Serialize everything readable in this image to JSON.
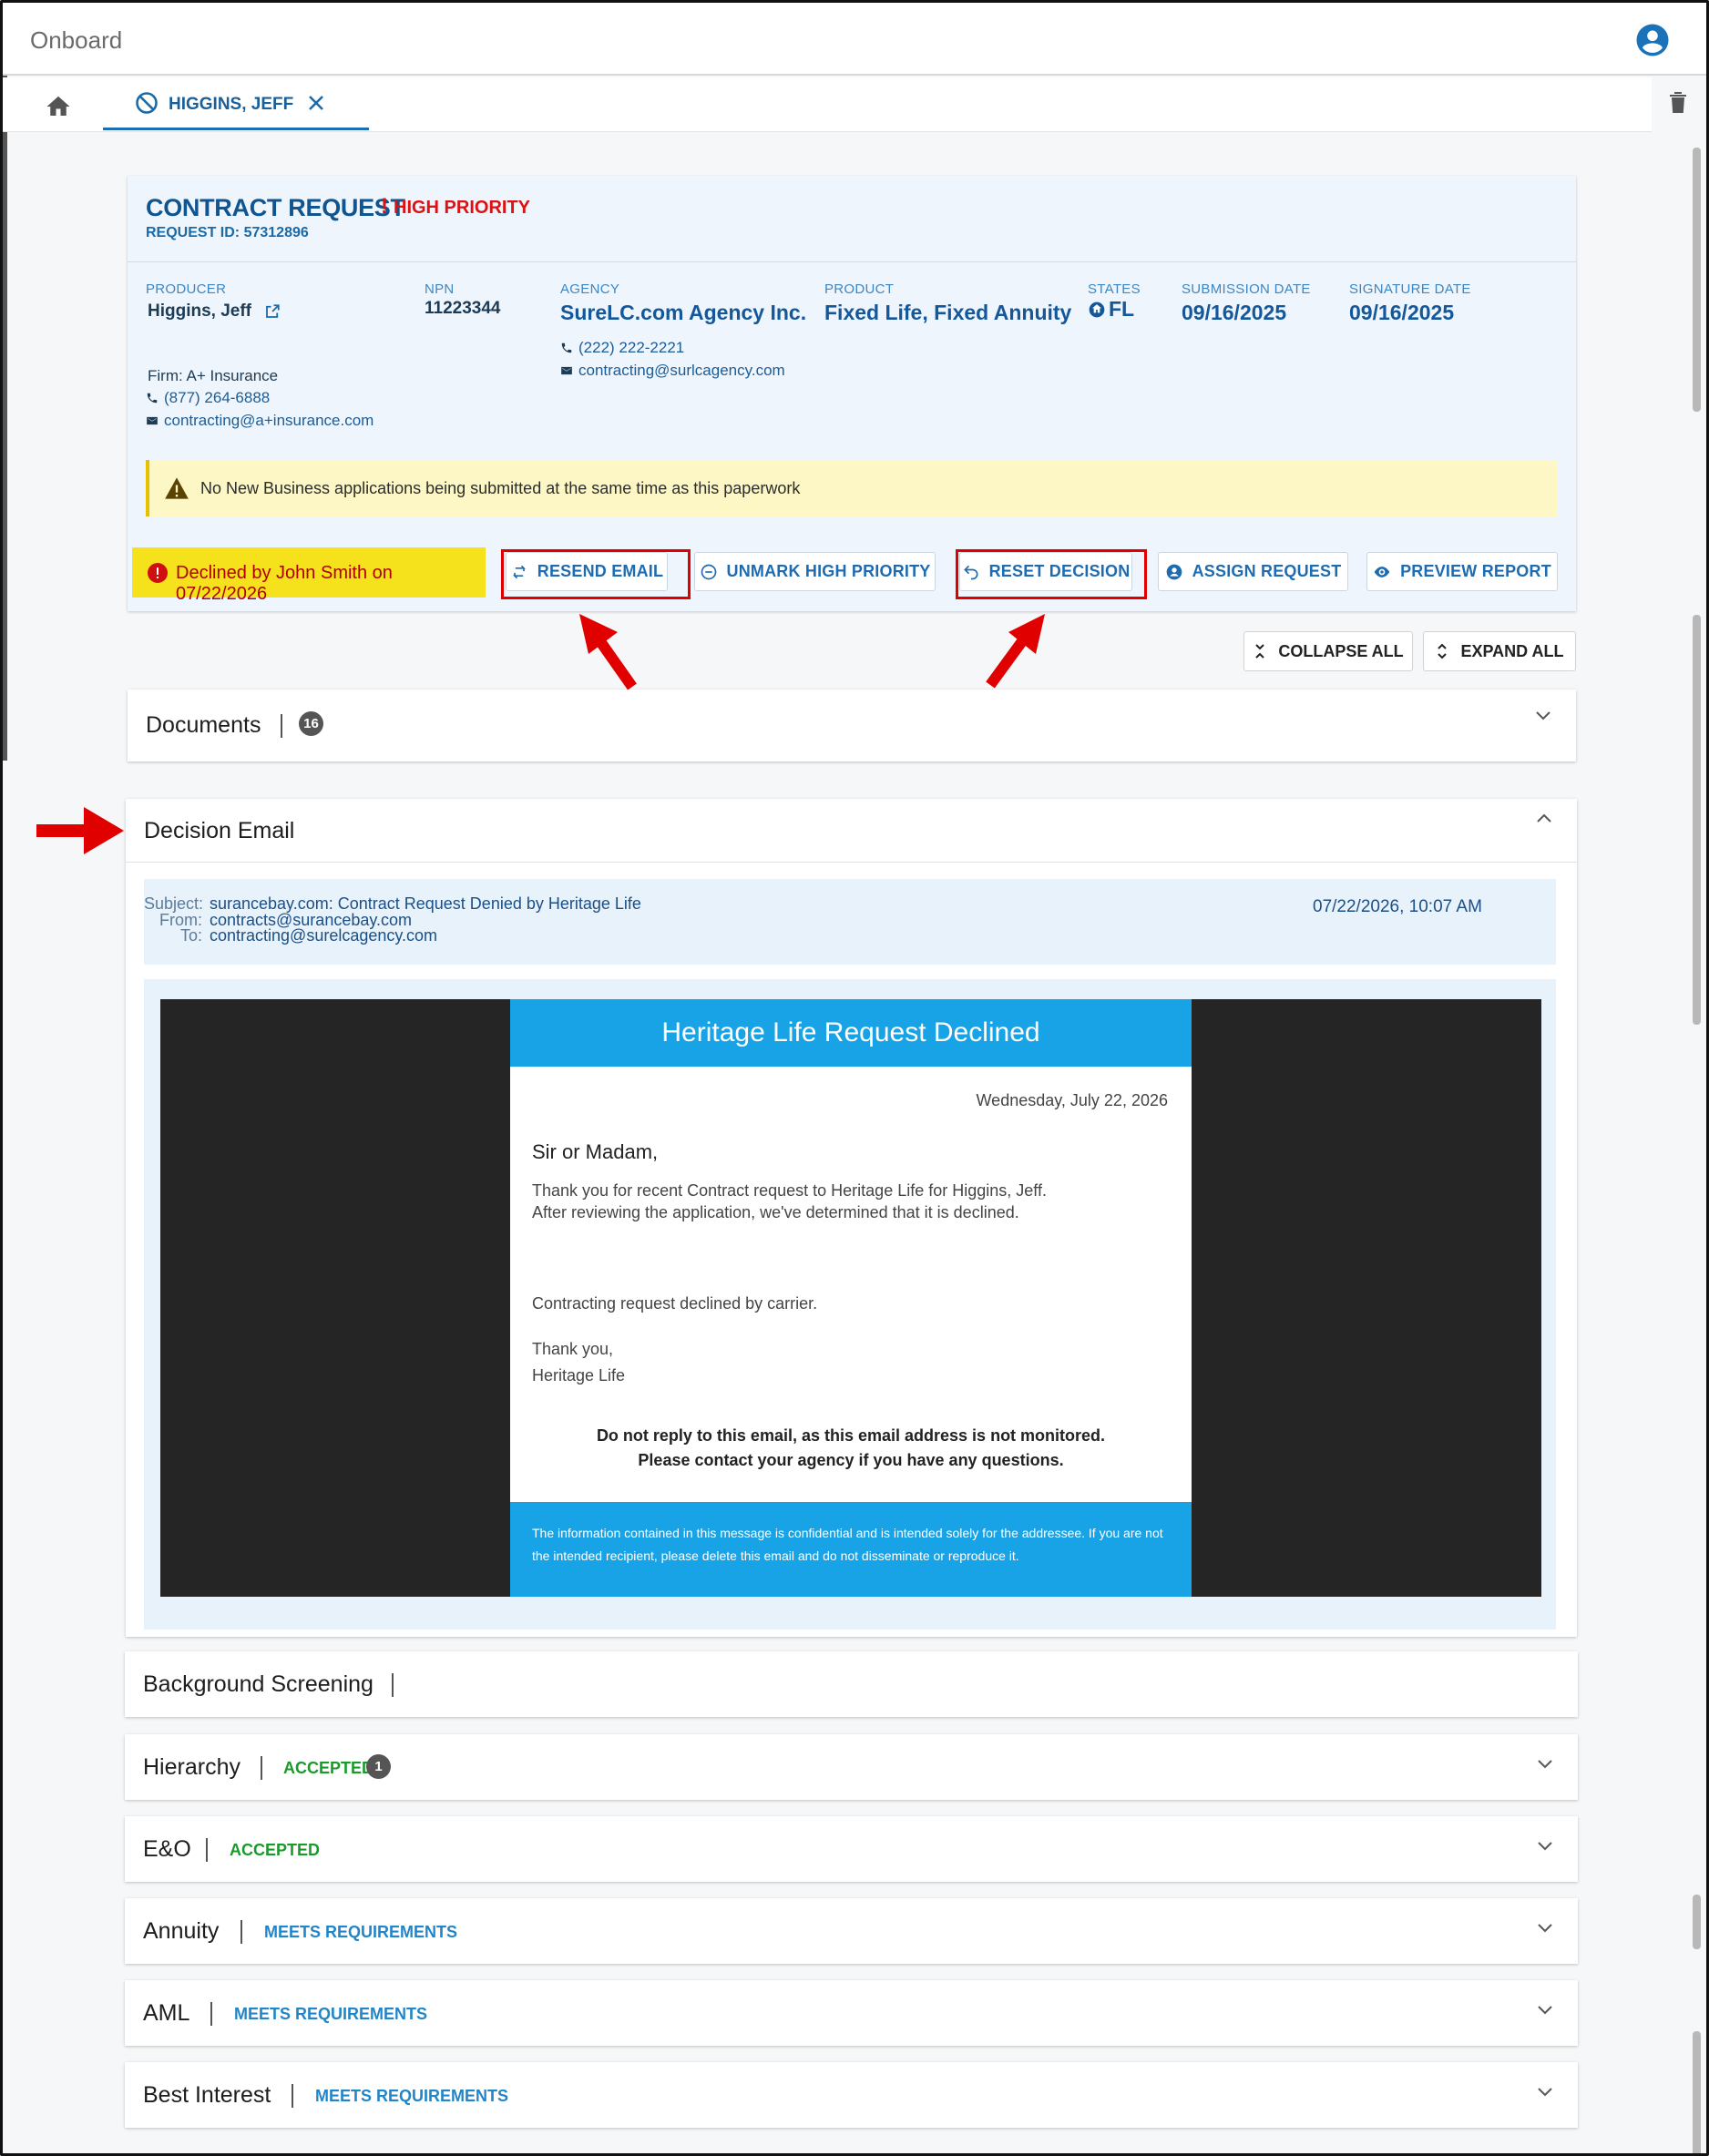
{
  "app": {
    "title": "Onboard"
  },
  "tabs": [
    {
      "label": "HIGGINS, JEFF"
    }
  ],
  "request": {
    "title": "CONTRACT REQUEST",
    "priority": "HIGH PRIORITY",
    "request_id_label": "REQUEST ID:",
    "request_id": "57312896",
    "producer": {
      "label": "PRODUCER",
      "name": "Higgins, Jeff",
      "firm": "Firm: A+ Insurance",
      "phone": "(877) 264-6888",
      "email": "contracting@a+insurance.com"
    },
    "npn": {
      "label": "NPN",
      "value": "11223344"
    },
    "agency": {
      "label": "AGENCY",
      "name": "SureLC.com Agency Inc.",
      "phone": "(222) 222-2221",
      "email": "contracting@surlcagency.com"
    },
    "product": {
      "label": "PRODUCT",
      "value": "Fixed Life, Fixed Annuity"
    },
    "states": {
      "label": "STATES",
      "value": "FL"
    },
    "submission_date": {
      "label": "SUBMISSION DATE",
      "value": "09/16/2025"
    },
    "signature_date": {
      "label": "SIGNATURE DATE",
      "value": "09/16/2025"
    },
    "warning": "No New Business applications being submitted at the same time as this paperwork",
    "declined_text": "Declined by John Smith  on 07/22/2026"
  },
  "actions": {
    "resend_email": "RESEND EMAIL",
    "unmark_high_priority": "UNMARK HIGH PRIORITY",
    "reset_decision": "RESET DECISION",
    "assign_request": "ASSIGN REQUEST",
    "preview_report": "PREVIEW REPORT",
    "collapse_all": "COLLAPSE ALL",
    "expand_all": "EXPAND ALL"
  },
  "sections": {
    "documents": {
      "title": "Documents",
      "count": "16"
    },
    "decision_email": {
      "title": "Decision Email",
      "subject_label": "Subject:",
      "subject": "surancebay.com: Contract Request Denied by Heritage Life",
      "from_label": "From:",
      "from": "contracts@surancebay.com",
      "to_label": "To:",
      "to": "contracting@surelcagency.com",
      "timestamp": "07/22/2026, 10:07 AM",
      "email": {
        "header": "Heritage Life Request Declined",
        "date": "Wednesday, July 22, 2026",
        "greeting": "Sir or Madam,",
        "line1": "Thank you for recent Contract request to Heritage Life for Higgins, Jeff.",
        "line2": "After reviewing the application, we've determined that it is declined.",
        "reason": "Contracting request declined by carrier.",
        "thanks": "Thank you,",
        "signature": "Heritage Life",
        "notice1": "Do not reply to this email, as this email address is not monitored.",
        "notice2": "Please contact your agency if you have any questions.",
        "footer": "The information contained in this message is confidential and is intended solely for the addressee. If you are not the intended recipient, please delete this email and do not disseminate or reproduce it."
      }
    },
    "background_screening": {
      "title": "Background Screening"
    },
    "hierarchy": {
      "title": "Hierarchy",
      "status": "ACCEPTED",
      "count": "1"
    },
    "eo": {
      "title": "E&O",
      "status": "ACCEPTED"
    },
    "annuity": {
      "title": "Annuity",
      "status": "MEETS REQUIREMENTS"
    },
    "aml": {
      "title": "AML",
      "status": "MEETS REQUIREMENTS"
    },
    "best_interest": {
      "title": "Best Interest",
      "status": "MEETS REQUIREMENTS"
    }
  },
  "colors": {
    "primary": "#1d6fb0",
    "danger": "#dd1111",
    "success": "#1a9a2b",
    "info": "#2285c8",
    "email_accent": "#17a3e6"
  }
}
